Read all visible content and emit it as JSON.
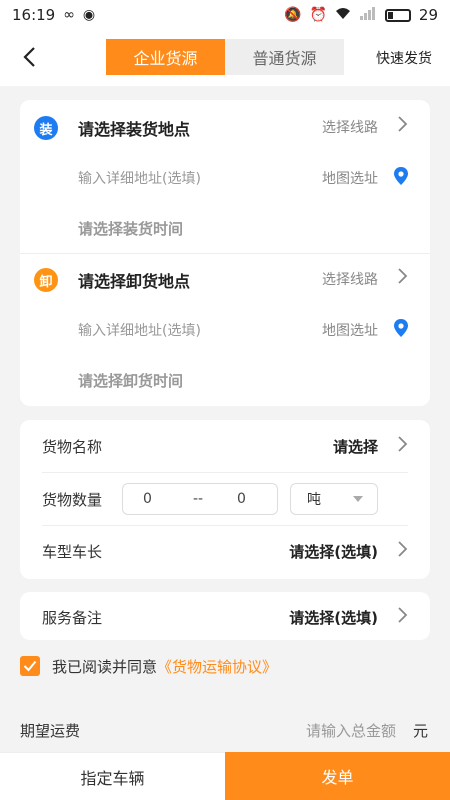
{
  "status_bar": {
    "time": "16:19",
    "battery": "29",
    "icons": [
      "infinity-icon",
      "app-icon",
      "mute-icon",
      "alarm-icon",
      "wifi-icon",
      "signal-icon",
      "battery-icon"
    ]
  },
  "header": {
    "back_icon": "chevron-left-icon",
    "tabs": [
      {
        "label": "企业货源",
        "active": true
      },
      {
        "label": "普通货源",
        "active": false
      }
    ],
    "quick_label": "快速发货"
  },
  "load": {
    "badge": "装",
    "title": "请选择装货地点",
    "route_label": "选择线路",
    "address_placeholder": "输入详细地址(选填)",
    "map_label": "地图选址",
    "time_label": "请选择装货时间"
  },
  "unload": {
    "badge": "卸",
    "title": "请选择卸货地点",
    "route_label": "选择线路",
    "address_placeholder": "输入详细地址(选填)",
    "map_label": "地图选址",
    "time_label": "请选择卸货时间"
  },
  "cargo": {
    "name_label": "货物名称",
    "name_value": "请选择",
    "qty_label": "货物数量",
    "qty_min": "0",
    "qty_sep": "--",
    "qty_max": "0",
    "unit_value": "吨",
    "truck_label": "车型车长",
    "truck_value": "请选择(选填)"
  },
  "service": {
    "label": "服务备注",
    "value": "请选择(选填)"
  },
  "agreement": {
    "checked": true,
    "text": "我已阅读并同意",
    "link": "《货物运输协议》"
  },
  "fee": {
    "label": "期望运费",
    "placeholder": "请输入总金额",
    "unit": "元"
  },
  "actions": {
    "assign_label": "指定车辆",
    "submit_label": "发单"
  },
  "colors": {
    "accent": "#ff8c1a",
    "load_badge": "#1e7cf2",
    "unload_badge": "#ff9414",
    "pin": "#1e7cf2"
  }
}
